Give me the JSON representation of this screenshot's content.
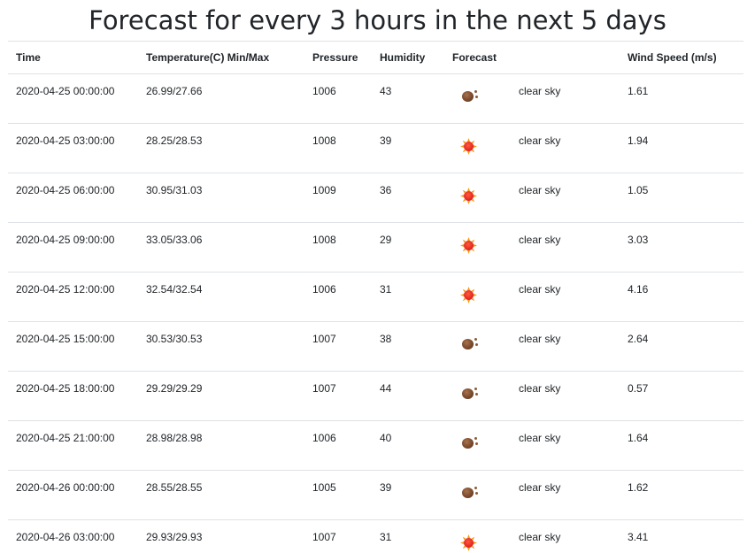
{
  "page": {
    "title": "Forecast for every 3 hours in the next 5 days"
  },
  "table": {
    "headers": {
      "time": "Time",
      "temperature": "Temperature(C) Min/Max",
      "pressure": "Pressure",
      "humidity": "Humidity",
      "forecast": "Forecast",
      "description": "",
      "wind": "Wind Speed (m/s)"
    },
    "rows": [
      {
        "time": "2020-04-25 00:00:00",
        "temp": "26.99/27.66",
        "pressure": "1006",
        "humidity": "43",
        "icon": "moon-icon",
        "description": "clear sky",
        "wind": "1.61"
      },
      {
        "time": "2020-04-25 03:00:00",
        "temp": "28.25/28.53",
        "pressure": "1008",
        "humidity": "39",
        "icon": "sun-icon",
        "description": "clear sky",
        "wind": "1.94"
      },
      {
        "time": "2020-04-25 06:00:00",
        "temp": "30.95/31.03",
        "pressure": "1009",
        "humidity": "36",
        "icon": "sun-icon",
        "description": "clear sky",
        "wind": "1.05"
      },
      {
        "time": "2020-04-25 09:00:00",
        "temp": "33.05/33.06",
        "pressure": "1008",
        "humidity": "29",
        "icon": "sun-icon",
        "description": "clear sky",
        "wind": "3.03"
      },
      {
        "time": "2020-04-25 12:00:00",
        "temp": "32.54/32.54",
        "pressure": "1006",
        "humidity": "31",
        "icon": "sun-icon",
        "description": "clear sky",
        "wind": "4.16"
      },
      {
        "time": "2020-04-25 15:00:00",
        "temp": "30.53/30.53",
        "pressure": "1007",
        "humidity": "38",
        "icon": "moon-icon",
        "description": "clear sky",
        "wind": "2.64"
      },
      {
        "time": "2020-04-25 18:00:00",
        "temp": "29.29/29.29",
        "pressure": "1007",
        "humidity": "44",
        "icon": "moon-icon",
        "description": "clear sky",
        "wind": "0.57"
      },
      {
        "time": "2020-04-25 21:00:00",
        "temp": "28.98/28.98",
        "pressure": "1006",
        "humidity": "40",
        "icon": "moon-icon",
        "description": "clear sky",
        "wind": "1.64"
      },
      {
        "time": "2020-04-26 00:00:00",
        "temp": "28.55/28.55",
        "pressure": "1005",
        "humidity": "39",
        "icon": "moon-icon",
        "description": "clear sky",
        "wind": "1.62"
      },
      {
        "time": "2020-04-26 03:00:00",
        "temp": "29.93/29.93",
        "pressure": "1007",
        "humidity": "31",
        "icon": "sun-icon",
        "description": "clear sky",
        "wind": "3.41"
      }
    ]
  }
}
